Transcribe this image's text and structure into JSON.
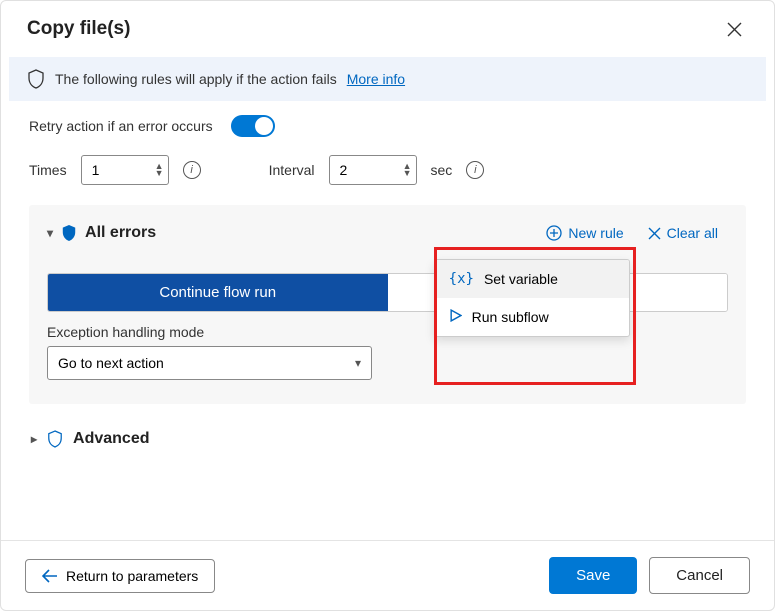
{
  "header": {
    "title": "Copy file(s)"
  },
  "info": {
    "text": "The following rules will apply if the action fails",
    "link": "More info"
  },
  "retry": {
    "label": "Retry action if an error occurs",
    "on": true,
    "times_label": "Times",
    "times_value": "1",
    "interval_label": "Interval",
    "interval_value": "2",
    "interval_unit": "sec"
  },
  "errors": {
    "title": "All errors",
    "new_rule": "New rule",
    "clear_all": "Clear all",
    "segments": {
      "active": "Continue flow run",
      "inactive": ""
    },
    "mode_label": "Exception handling mode",
    "mode_value": "Go to next action",
    "menu": {
      "set_variable": "Set variable",
      "run_subflow": "Run subflow"
    }
  },
  "advanced": {
    "title": "Advanced"
  },
  "footer": {
    "return": "Return to parameters",
    "save": "Save",
    "cancel": "Cancel"
  },
  "colors": {
    "accent": "#0078d4",
    "infobg": "#eef3fb",
    "danger": "#e62020"
  }
}
